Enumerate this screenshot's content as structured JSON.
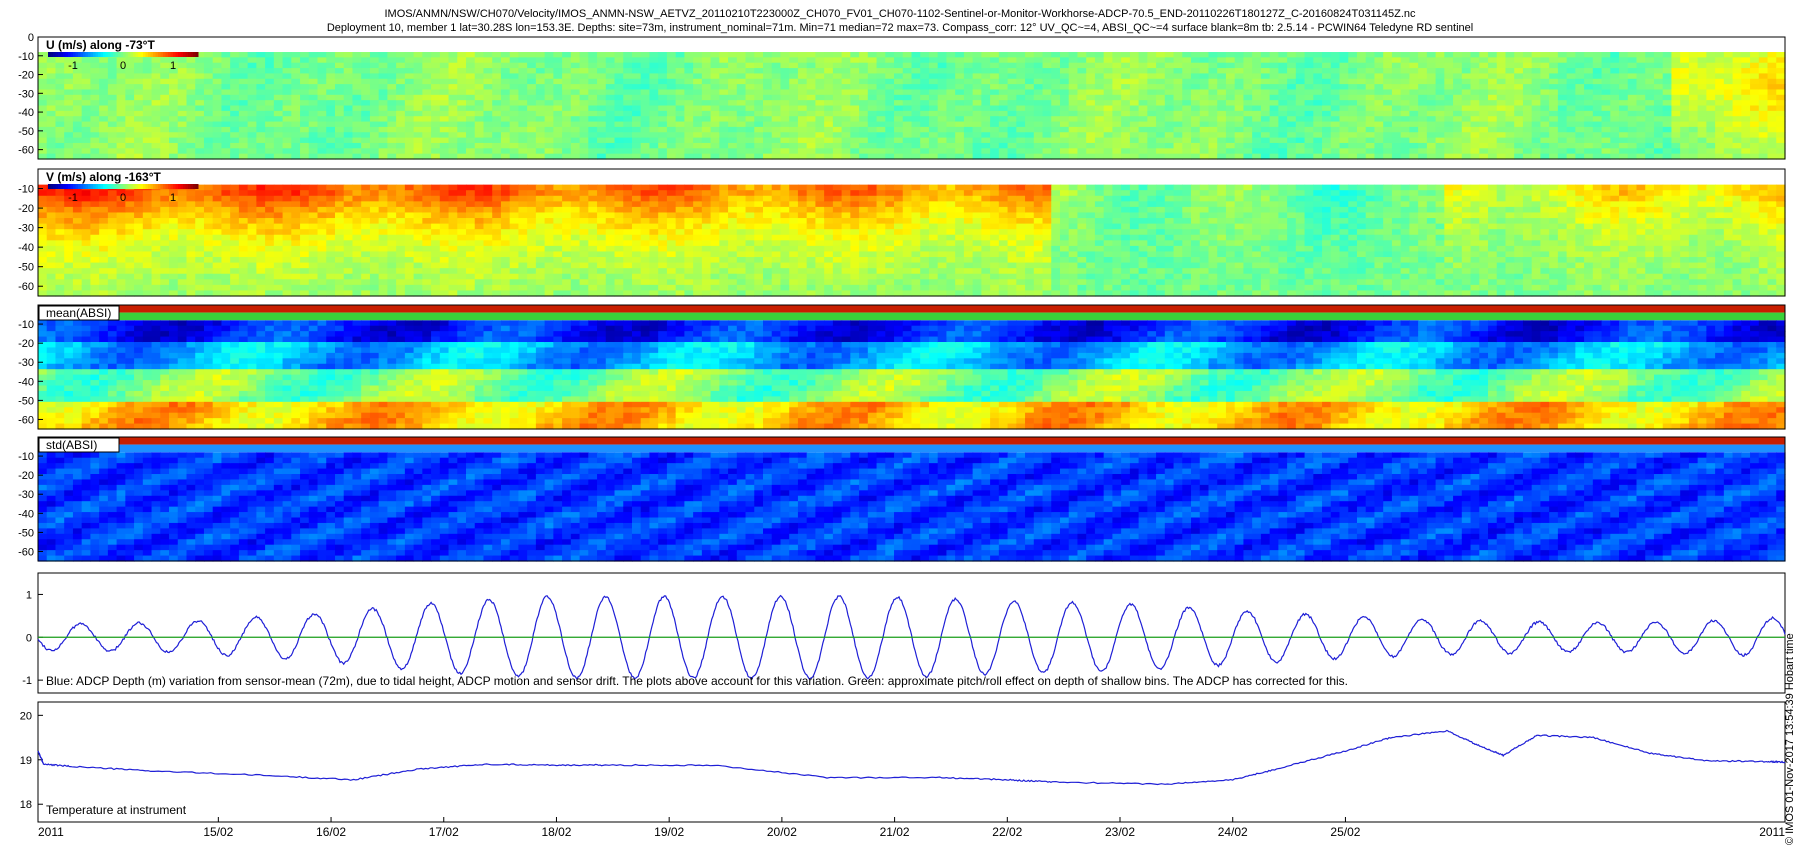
{
  "header": {
    "line1": "IMOS/ANMN/NSW/CH070/Velocity/IMOS_ANMN-NSW_AETVZ_20110210T223000Z_CH070_FV01_CH070-1102-Sentinel-or-Monitor-Workhorse-ADCP-70.5_END-20110226T180127Z_C-20160824T031145Z.nc",
    "line2": "Deployment 10, member 1 lat=30.28S lon=153.3E. Depths: site=73m, instrument_nominal=71m. Min=71 median=72 max=73. Compass_corr: 12° UV_QC~=4, ABSI_QC~=4 surface blank=8m tb: 2.5.14 - PCWIN64 Teledyne RD sentinel"
  },
  "side_note": "© IMOS 01-Nov-2017 13:54:39 Hobart time",
  "colors": {
    "depth_line": "#1f1fd6",
    "pitch_roll_line": "#1a9e1a",
    "temperature_line": "#1f1fd6",
    "qc_flag": "#22b422"
  },
  "chart_data": [
    {
      "type": "heatmap",
      "label": "U (m/s) along -73°T",
      "colormap": "jet",
      "colorbar": {
        "range": [
          -1.5,
          1.5
        ],
        "ticks": [
          -1,
          0,
          1
        ]
      },
      "ylim": [
        -65,
        0
      ],
      "yticks": [
        0,
        -10,
        -20,
        -30,
        -40,
        -50,
        -60
      ],
      "mean_pattern": "weak flow near zero, mostly green with small positive/negative patches"
    },
    {
      "type": "heatmap",
      "label": "V (m/s) along -163°T",
      "colormap": "jet",
      "colorbar": {
        "range": [
          -1.5,
          1.5
        ],
        "ticks": [
          -1,
          0,
          1
        ]
      },
      "ylim": [
        -65,
        0
      ],
      "yticks": [
        -10,
        -20,
        -30,
        -40,
        -50,
        -60
      ],
      "mean_pattern": "strong positive flow in upper layer early in deployment, weakening to near zero around 22/02-23/02, returning positive near 25/02"
    },
    {
      "type": "heatmap",
      "label": "mean(ABSI)",
      "colormap": "jet",
      "ylim": [
        -65,
        0
      ],
      "yticks": [
        -10,
        -20,
        -30,
        -40,
        -50,
        -60
      ]
    },
    {
      "type": "heatmap",
      "label": "std(ABSI)",
      "colormap": "jet",
      "ylim": [
        -65,
        0
      ],
      "yticks": [
        -10,
        -20,
        -30,
        -40,
        -50,
        -60
      ]
    },
    {
      "type": "line",
      "caption": "Blue: ADCP Depth (m) variation from sensor-mean (72m), due to tidal height, ADCP motion and sensor drift. The plots above account for this variation. Green: approximate pitch/roll effect on depth of shallow bins. The ADCP has corrected for this.",
      "ylim": [
        -1.3,
        1.5
      ],
      "yticks": [
        1,
        0,
        -1
      ],
      "series": [
        {
          "period_days": 0.5175,
          "phase_days": 0.25,
          "amplitude_points": [
            [
              0,
              0.3
            ],
            [
              1.2,
              0.35
            ],
            [
              2.5,
              0.55
            ],
            [
              3.5,
              0.8
            ],
            [
              4.5,
              0.95
            ],
            [
              5.5,
              0.95
            ],
            [
              6.5,
              0.95
            ],
            [
              7.5,
              0.95
            ],
            [
              8.5,
              0.85
            ],
            [
              9.5,
              0.8
            ],
            [
              10.5,
              0.65
            ],
            [
              11.5,
              0.5
            ],
            [
              12.5,
              0.4
            ],
            [
              13.5,
              0.35
            ],
            [
              14.5,
              0.35
            ],
            [
              15.4,
              0.45
            ]
          ],
          "offset": 0.0
        },
        {
          "values": [
            0,
            0
          ]
        }
      ]
    },
    {
      "type": "line",
      "caption": "Temperature at instrument",
      "ylim": [
        17.6,
        20.3
      ],
      "yticks": [
        20,
        19,
        18
      ],
      "series": [
        {
          "x": [
            0.0,
            0.05,
            0.3,
            1.0,
            2.0,
            2.8,
            3.4,
            4.0,
            4.6,
            5.0,
            6.0,
            7.0,
            8.0,
            8.6,
            9.0,
            10.0,
            10.6,
            11.0,
            11.6,
            12.0,
            12.5,
            12.8,
            13.0,
            13.3,
            13.8,
            14.3,
            14.8,
            15.3,
            15.5
          ],
          "values": [
            19.2,
            18.9,
            18.85,
            18.75,
            18.65,
            18.55,
            18.8,
            18.9,
            18.88,
            18.88,
            18.88,
            18.6,
            18.6,
            18.55,
            18.5,
            18.45,
            18.55,
            18.8,
            19.2,
            19.5,
            19.65,
            19.3,
            19.1,
            19.55,
            19.5,
            19.15,
            18.98,
            18.96,
            18.95
          ]
        }
      ]
    }
  ],
  "xaxis": {
    "range": [
      0,
      15.5
    ],
    "tick_labels": [
      {
        "x": 0.0,
        "label": "2011"
      },
      {
        "x": 1.6,
        "label": "15/02"
      },
      {
        "x": 2.6,
        "label": "16/02"
      },
      {
        "x": 3.6,
        "label": "17/02"
      },
      {
        "x": 4.6,
        "label": "18/02"
      },
      {
        "x": 5.6,
        "label": "19/02"
      },
      {
        "x": 6.6,
        "label": "20/02"
      },
      {
        "x": 7.6,
        "label": "21/02"
      },
      {
        "x": 8.6,
        "label": "22/02"
      },
      {
        "x": 9.6,
        "label": "23/02"
      },
      {
        "x": 10.6,
        "label": "24/02"
      },
      {
        "x": 11.6,
        "label": "25/02"
      },
      {
        "x": 15.5,
        "label": "2011"
      }
    ]
  }
}
